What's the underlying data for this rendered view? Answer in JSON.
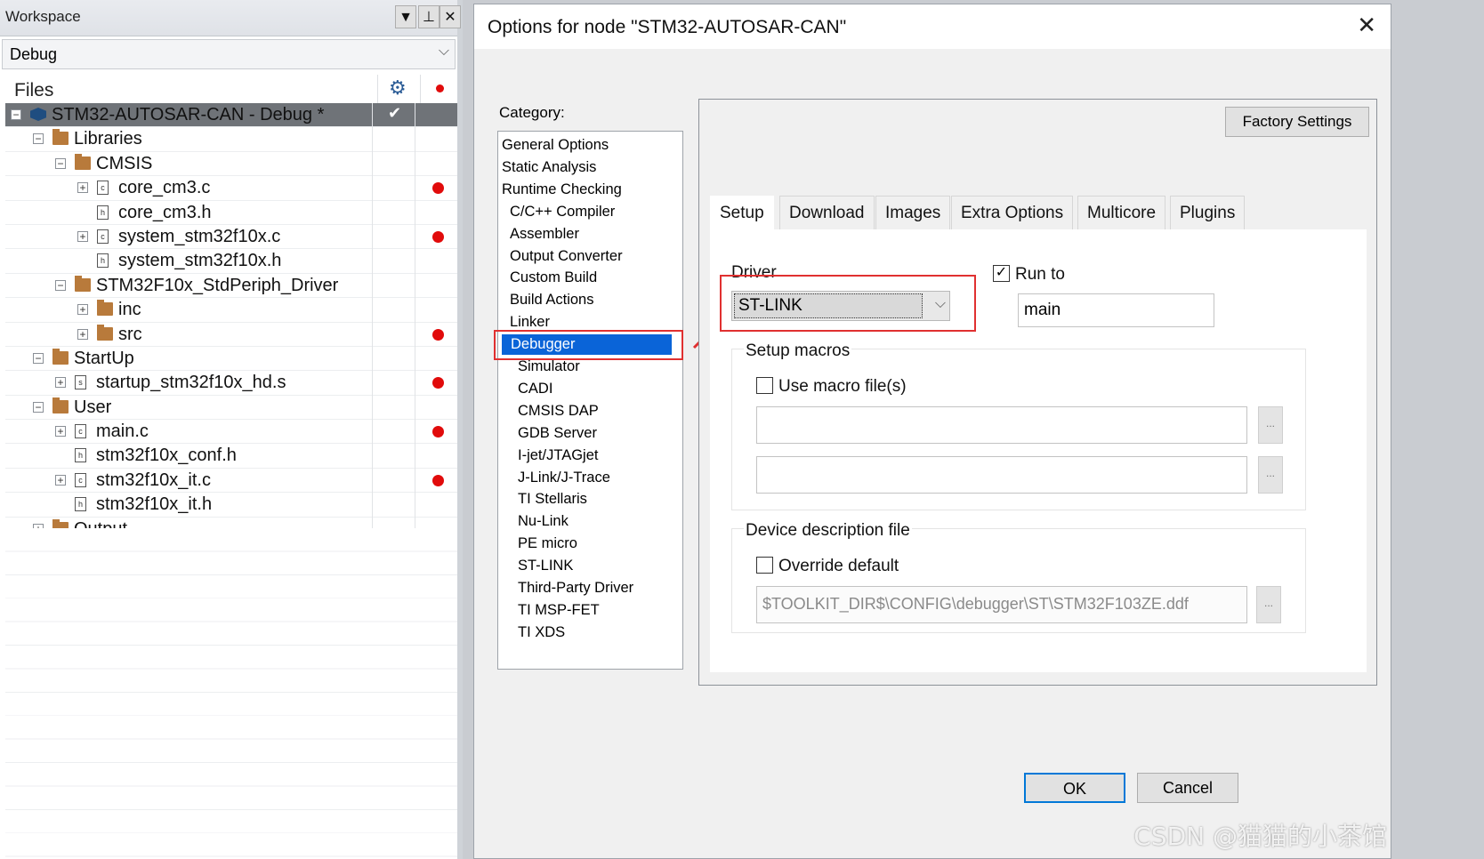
{
  "workspace": {
    "title": "Workspace",
    "config": "Debug",
    "files_header": "Files",
    "tree": [
      {
        "label": "STM32-AUTOSAR-CAN - Debug *",
        "level": 0,
        "kind": "project",
        "exp": "−",
        "dot": false,
        "check": true,
        "selected": true
      },
      {
        "label": "Libraries",
        "level": 1,
        "kind": "folder",
        "exp": "−",
        "dot": false
      },
      {
        "label": "CMSIS",
        "level": 2,
        "kind": "folder",
        "exp": "−",
        "dot": false
      },
      {
        "label": "core_cm3.c",
        "level": 3,
        "kind": "c",
        "exp": "+",
        "dot": true
      },
      {
        "label": "core_cm3.h",
        "level": 3,
        "kind": "h",
        "exp": "",
        "dot": false
      },
      {
        "label": "system_stm32f10x.c",
        "level": 3,
        "kind": "c",
        "exp": "+",
        "dot": true
      },
      {
        "label": "system_stm32f10x.h",
        "level": 3,
        "kind": "h",
        "exp": "",
        "dot": false
      },
      {
        "label": "STM32F10x_StdPeriph_Driver",
        "level": 2,
        "kind": "folder",
        "exp": "−",
        "dot": false
      },
      {
        "label": "inc",
        "level": 3,
        "kind": "folder",
        "exp": "+",
        "dot": false
      },
      {
        "label": "src",
        "level": 3,
        "kind": "folder",
        "exp": "+",
        "dot": true
      },
      {
        "label": "StartUp",
        "level": 1,
        "kind": "folder",
        "exp": "−",
        "dot": false
      },
      {
        "label": "startup_stm32f10x_hd.s",
        "level": 2,
        "kind": "s",
        "exp": "+",
        "dot": true
      },
      {
        "label": "User",
        "level": 1,
        "kind": "folder",
        "exp": "−",
        "dot": false
      },
      {
        "label": "main.c",
        "level": 2,
        "kind": "c",
        "exp": "+",
        "dot": true
      },
      {
        "label": "stm32f10x_conf.h",
        "level": 2,
        "kind": "h",
        "exp": "",
        "dot": false
      },
      {
        "label": "stm32f10x_it.c",
        "level": 2,
        "kind": "c",
        "exp": "+",
        "dot": true
      },
      {
        "label": "stm32f10x_it.h",
        "level": 2,
        "kind": "h",
        "exp": "",
        "dot": false
      },
      {
        "label": "Output",
        "level": 1,
        "kind": "folder",
        "exp": "+",
        "dot": false
      }
    ]
  },
  "dialog": {
    "title": "Options for node \"STM32-AUTOSAR-CAN\"",
    "category_label": "Category:",
    "categories": [
      {
        "label": "General Options",
        "indent": 0
      },
      {
        "label": "Static Analysis",
        "indent": 0
      },
      {
        "label": "Runtime Checking",
        "indent": 0
      },
      {
        "label": "C/C++ Compiler",
        "indent": 1
      },
      {
        "label": "Assembler",
        "indent": 1
      },
      {
        "label": "Output Converter",
        "indent": 1
      },
      {
        "label": "Custom Build",
        "indent": 1
      },
      {
        "label": "Build Actions",
        "indent": 1
      },
      {
        "label": "Linker",
        "indent": 1
      },
      {
        "label": "Debugger",
        "indent": 1,
        "selected": true
      },
      {
        "label": "Simulator",
        "indent": 2
      },
      {
        "label": "CADI",
        "indent": 2
      },
      {
        "label": "CMSIS DAP",
        "indent": 2
      },
      {
        "label": "GDB Server",
        "indent": 2
      },
      {
        "label": "I-jet/JTAGjet",
        "indent": 2
      },
      {
        "label": "J-Link/J-Trace",
        "indent": 2
      },
      {
        "label": "TI Stellaris",
        "indent": 2
      },
      {
        "label": "Nu-Link",
        "indent": 2
      },
      {
        "label": "PE micro",
        "indent": 2
      },
      {
        "label": "ST-LINK",
        "indent": 2
      },
      {
        "label": "Third-Party Driver",
        "indent": 2
      },
      {
        "label": "TI MSP-FET",
        "indent": 2
      },
      {
        "label": "TI XDS",
        "indent": 2
      }
    ],
    "factory_settings": "Factory Settings",
    "tabs": [
      "Setup",
      "Download",
      "Images",
      "Extra Options",
      "Multicore",
      "Plugins"
    ],
    "active_tab": "Setup",
    "setup": {
      "driver_label": "Driver",
      "driver_value": "ST-LINK",
      "run_to_label": "Run to",
      "run_to_checked": true,
      "run_to_value": "main",
      "setup_macros_label": "Setup macros",
      "use_macro_label": "Use macro file(s)",
      "use_macro_checked": false,
      "macro_file_1": "",
      "macro_file_2": "",
      "browse_label": "...",
      "device_desc_label": "Device description file",
      "override_label": "Override default",
      "override_checked": false,
      "ddf_path": "$TOOLKIT_DIR$\\CONFIG\\debugger\\ST\\STM32F103ZE.ddf"
    },
    "ok": "OK",
    "cancel": "Cancel"
  },
  "watermark": "CSDN @猫猫的小茶馆",
  "colors": {
    "selection": "#0a64d8",
    "highlight": "#e03030",
    "breakpoint": "#e10b0b",
    "tree_selected": "#6f7378"
  }
}
